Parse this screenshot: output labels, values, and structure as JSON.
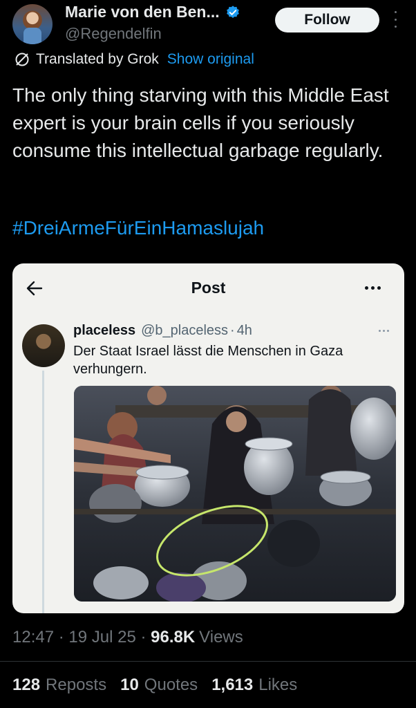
{
  "author": {
    "display_name": "Marie von den Ben...",
    "handle": "@Regendelfin",
    "follow_label": "Follow"
  },
  "translation": {
    "label": "Translated by Grok",
    "show_original": "Show original"
  },
  "tweet": {
    "text": "The only thing starving with this Middle East expert is your brain cells if you seriously consume this intellectual garbage regularly.",
    "hashtag": "#DreiArmeFürEinHamaslujah"
  },
  "embedded_post": {
    "title": "Post",
    "author_name": "placeless",
    "author_handle": "@b_placeless",
    "separator": "·",
    "time": "4h",
    "text": "Der Staat Israel lässt die Menschen in Gaza verhungern."
  },
  "meta": {
    "time": "12:47",
    "sep1": " · ",
    "date": "19 Jul 25",
    "sep2": " · ",
    "views_count": "96.8K",
    "views_label": "Views"
  },
  "stats": {
    "reposts_count": "128",
    "reposts_label": "Reposts",
    "quotes_count": "10",
    "quotes_label": "Quotes",
    "likes_count": "1,613",
    "likes_label": "Likes"
  },
  "colors": {
    "background": "#000000",
    "link": "#1d9bf0",
    "secondary_text": "#71767b",
    "embed_background": "#f2f2ef",
    "circle_annotation": "#c6e66b"
  },
  "icons": [
    "verified-badge-icon",
    "more-icon",
    "grok-translate-icon",
    "back-arrow-icon"
  ]
}
